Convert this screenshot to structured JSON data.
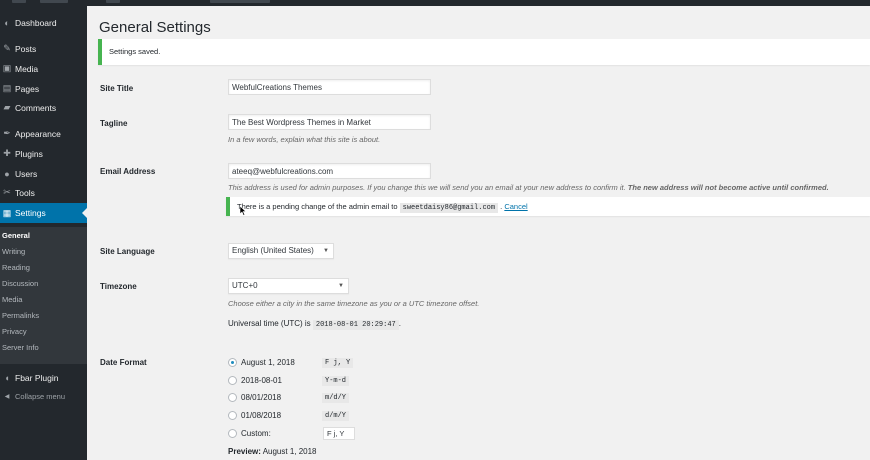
{
  "sidebar": {
    "menu": [
      {
        "label": "Dashboard",
        "icon": "dashboard-icon",
        "glyph": "◐"
      },
      {
        "label": "Posts",
        "icon": "pin-icon",
        "glyph": "✎"
      },
      {
        "label": "Media",
        "icon": "media-icon",
        "glyph": "▣"
      },
      {
        "label": "Pages",
        "icon": "pages-icon",
        "glyph": "▤"
      },
      {
        "label": "Comments",
        "icon": "comments-icon",
        "glyph": "▰"
      },
      {
        "label": "Appearance",
        "icon": "appearance-icon",
        "glyph": "✒"
      },
      {
        "label": "Plugins",
        "icon": "plugins-icon",
        "glyph": "✚"
      },
      {
        "label": "Users",
        "icon": "users-icon",
        "glyph": "●"
      },
      {
        "label": "Tools",
        "icon": "tools-icon",
        "glyph": "✂"
      },
      {
        "label": "Settings",
        "icon": "settings-icon",
        "glyph": "▦"
      }
    ],
    "submenu": [
      "General",
      "Writing",
      "Reading",
      "Discussion",
      "Media",
      "Permalinks",
      "Privacy",
      "Server Info"
    ],
    "extra": [
      {
        "label": "Fbar Plugin",
        "icon": "plugin-icon",
        "glyph": "◖"
      },
      {
        "label": "Collapse menu",
        "icon": "collapse-icon",
        "glyph": "◀"
      }
    ]
  },
  "page": {
    "title": "General Settings",
    "notice": "Settings saved."
  },
  "fields": {
    "site_title": {
      "label": "Site Title",
      "value": "WebfulCreations Themes"
    },
    "tagline": {
      "label": "Tagline",
      "value": "The Best Wordpress Themes in Market",
      "description": "In a few words, explain what this site is about."
    },
    "email": {
      "label": "Email Address",
      "value": "ateeq@webfulcreations.com",
      "description": "This address is used for admin purposes. If you change this we will send you an email at your new address to confirm it.",
      "description_bold": "The new address will not become active until confirmed.",
      "pending_prefix": "There is a pending change of the admin email to",
      "pending_email": "sweetdaisy86@gmail.com",
      "pending_sep": ".",
      "pending_cancel": "Cancel"
    },
    "language": {
      "label": "Site Language",
      "value": "English (United States)"
    },
    "timezone": {
      "label": "Timezone",
      "value": "UTC+0",
      "description": "Choose either a city in the same timezone as you or a UTC timezone offset.",
      "utc_prefix": "Universal time (UTC) is",
      "utc_value": "2018-08-01 20:29:47",
      "utc_suffix": "."
    },
    "date_format": {
      "label": "Date Format",
      "options": [
        {
          "label": "August 1, 2018",
          "format": "F j, Y",
          "checked": true
        },
        {
          "label": "2018-08-01",
          "format": "Y-m-d",
          "checked": false
        },
        {
          "label": "08/01/2018",
          "format": "m/d/Y",
          "checked": false
        },
        {
          "label": "01/08/2018",
          "format": "d/m/Y",
          "checked": false
        },
        {
          "label": "Custom:",
          "format": "",
          "checked": false
        }
      ],
      "custom_value": "F j, Y",
      "preview_label": "Preview:",
      "preview_value": "August 1, 2018"
    }
  },
  "colors": {
    "accent": "#0073aa",
    "success": "#46b450",
    "sidebar": "#23282d"
  }
}
